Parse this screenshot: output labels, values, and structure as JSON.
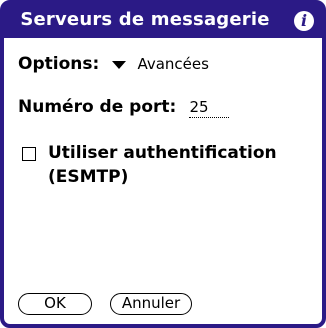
{
  "dialog": {
    "title": "Serveurs de messagerie",
    "info_icon": "info-icon"
  },
  "options": {
    "label": "Options:",
    "selected": "Avancées",
    "dropdown_icon": "triangle-down-icon"
  },
  "port": {
    "label": "Numéro de port:",
    "value": "25"
  },
  "auth": {
    "checked": false,
    "label_line1": "Utiliser authentification",
    "label_line2": "(ESMTP)"
  },
  "buttons": {
    "ok": "OK",
    "cancel": "Annuler"
  },
  "colors": {
    "accent": "#2b1a86"
  }
}
